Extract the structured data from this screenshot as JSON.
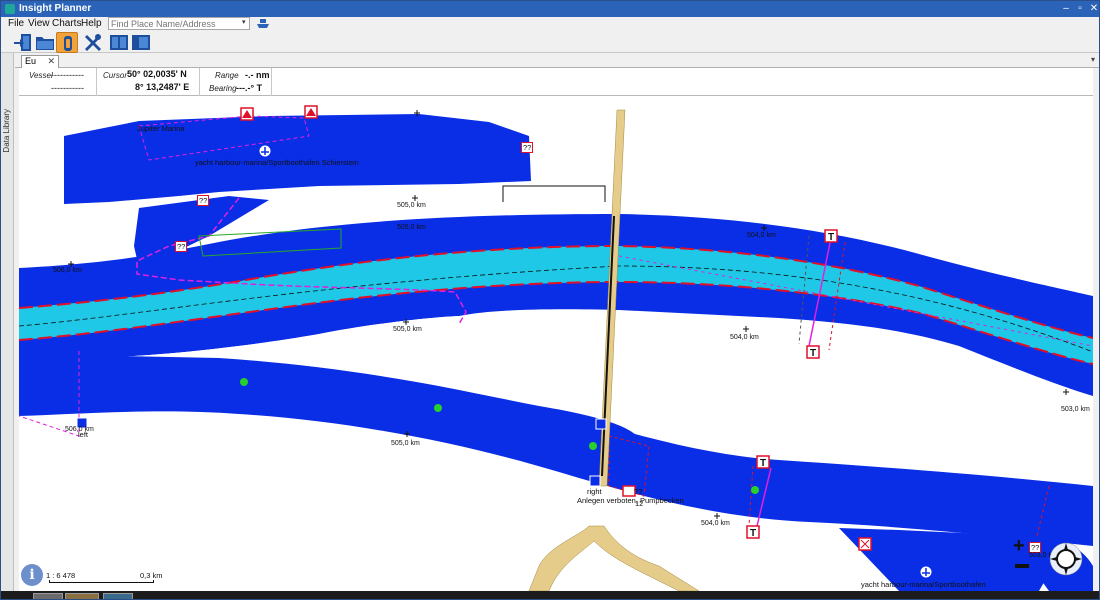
{
  "window": {
    "title": "Insight Planner",
    "minimize": "–",
    "restore": "▫",
    "close": "✕"
  },
  "menu": {
    "items": [
      "File",
      "View",
      "Charts",
      "Help"
    ]
  },
  "search": {
    "placeholder": "Find Place Name/Address",
    "dropdown_arrow": "▾"
  },
  "sidebar": {
    "label": "Data Library"
  },
  "tab": {
    "label": "Eu",
    "close": "✕",
    "menu_arrow": "▾"
  },
  "infobar": {
    "vessel_label": "Vessel",
    "vessel_line1": "-----------",
    "vessel_line2": "-----------",
    "cursor_label": "Cursor",
    "cursor_lat": "50° 02,0035' N",
    "cursor_lon": "8° 13,2487' E",
    "range_label": "Range",
    "range_value": "-.- nm",
    "bearing_label": "Bearing",
    "bearing_value": "---.-° T"
  },
  "map": {
    "labels": {
      "harbour_top": "yacht harbour-marina/Sportboothafen Schierstein",
      "harbour_top_name": "Jupiter Marina",
      "harbour_bottom": "yacht harbour-marina/Sportboothafen",
      "anlegen": "Anlegen verboten, Pumpbecken",
      "left": "left",
      "right": "right",
      "unknown": "??",
      "unknown_small": "12"
    },
    "km": {
      "k505_top": "505,0 km",
      "k505_top2": "505,0 km",
      "k504_top": "504,0 km",
      "k506_left": "506,0 km",
      "k505_mid": "505,0 km",
      "k504_mid": "504,0 km",
      "k503_right": "503,0 km",
      "k506_bottom": "506,0 km",
      "k505_bottom": "505,0 km",
      "k504_bottom": "504,0 km",
      "k503_bottom": "503,0 km"
    }
  },
  "scale": {
    "ratio": "1 : 6 478",
    "distance": "0,3 km"
  },
  "controls": {
    "info": "i",
    "zoom_in": "+",
    "zoom_out": "−"
  },
  "colors": {
    "water_deep": "#0a2ee6",
    "water_channel": "#1ec8e6",
    "fairway_red": "#e0102a",
    "route_magenta": "#e020e0",
    "bridge": "#e6cc8a",
    "titlebar": "#2a63b8"
  },
  "icons": [
    "app-icon",
    "ship-icon",
    "exit-icon",
    "folder-icon",
    "lifebuoy-icon",
    "tools-icon",
    "split-view-icon",
    "single-view-icon",
    "info-icon",
    "compass-icon"
  ]
}
